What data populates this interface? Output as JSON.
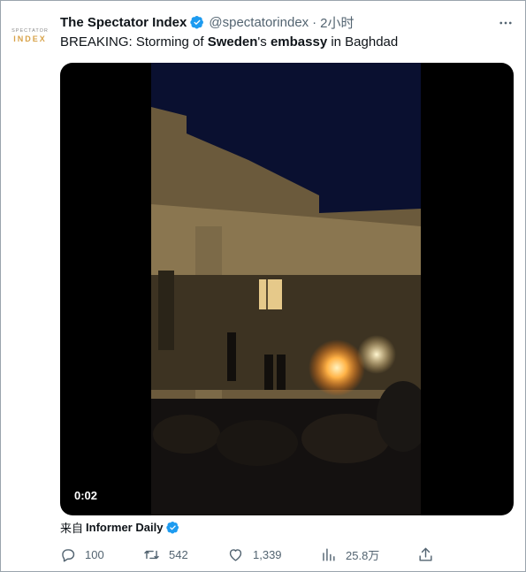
{
  "account": {
    "logo_line1": "SPECTATOR",
    "logo_line2": "INDEX",
    "name": "The Spectator Index",
    "handle": "@spectatorindex",
    "separator": "·",
    "time": "2小时"
  },
  "tweet": {
    "text_parts": [
      "BREAKING: Storming of ",
      "Sweden",
      "'s ",
      "embassy",
      " in Baghdad"
    ]
  },
  "media": {
    "type": "video",
    "timecode": "0:02"
  },
  "source": {
    "prefix": "来自",
    "name": "Informer Daily"
  },
  "actions": {
    "replies": "100",
    "retweets": "542",
    "likes": "1,339",
    "views": "25.8万"
  },
  "colors": {
    "verified": "#1d9bf0",
    "secondary_text": "#536471",
    "logo_accent": "#d8a34a"
  },
  "icons": [
    "verified-badge-icon",
    "more-icon",
    "reply-icon",
    "retweet-icon",
    "like-icon",
    "views-icon",
    "share-icon"
  ]
}
